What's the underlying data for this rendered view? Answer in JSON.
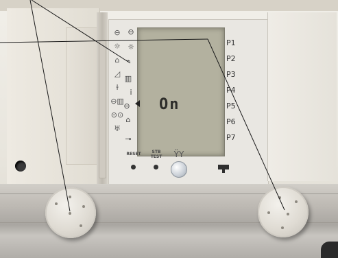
{
  "display": {
    "status_text": "On"
  },
  "programs": {
    "labels": [
      "P1",
      "P2",
      "P3",
      "P4",
      "P5",
      "P6",
      "P7"
    ]
  },
  "buttons": {
    "reset_label": "RESET",
    "stb_test_label": "STB TEST",
    "symbol_label": "ŸY"
  },
  "side_icons": [
    "clock-icon",
    "sun-icon",
    "burner-icon",
    "ramp-icon",
    "tap-icon",
    "radiator-icon",
    "info-icon",
    "battery-icon",
    "clock-setting-icon",
    "circuit-icon",
    "home-icon",
    "service-icon",
    "key-icon"
  ]
}
